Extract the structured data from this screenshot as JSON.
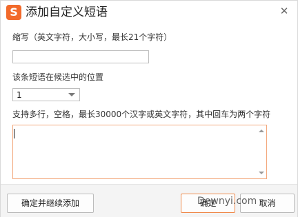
{
  "window": {
    "title": "添加自定义短语",
    "logo_glyph": "S",
    "close_glyph": "✕"
  },
  "form": {
    "abbr_label": "缩写（英文字符，大小写，最长21个字符）",
    "abbr_value": "",
    "position_label": "该条短语在候选中的位置",
    "position_value": "1",
    "content_label": "支持多行，空格，最长30000个汉字或英文字符，其中回车为两个字符",
    "content_value": ""
  },
  "buttons": {
    "continue_label": "确定并继续添加",
    "ok_label": "确定",
    "cancel_label": "取消"
  },
  "watermark": {
    "text": "Dewnyi.com"
  },
  "colors": {
    "accent": "#f26a2b",
    "focus_border": "#f3a77a"
  }
}
